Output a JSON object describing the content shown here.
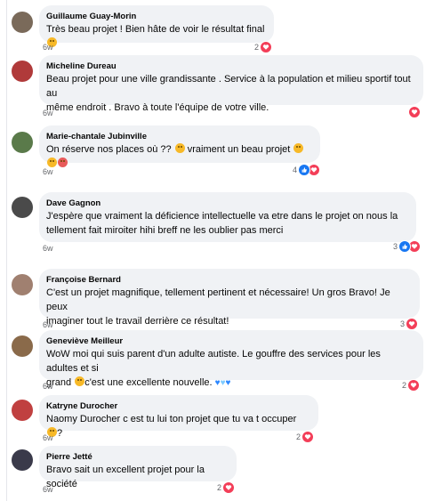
{
  "comments": [
    {
      "name": "Guillaume Guay-Morin",
      "line1": "Très beau projet ! Bien hâte de voir le résultat final",
      "line2": "",
      "time": "6w",
      "reactions": "2",
      "avatar_color": "#7a6a5a"
    },
    {
      "name": "Micheline Dureau",
      "line1": "Beau projet pour une ville grandissante . Service à la population et milieu sportif tout au",
      "line2": "même endroit . Bravo à toute l'équipe de votre ville.",
      "time": "6w",
      "reactions": "",
      "avatar_color": "#b03a3a"
    },
    {
      "name": "Marie-chantale Jubinville",
      "line1": "On réserve nos places où ?? ",
      "line1b": " vraiment un beau projet ",
      "line2": "",
      "time": "6w",
      "reactions": "4",
      "avatar_color": "#5a7a4a"
    },
    {
      "name": "Dave Gagnon",
      "line1": "J'espère que vraiment la déficience intellectuelle va etre dans le projet on nous la",
      "line2": "tellement fait miroiter hihi breff ne les oublier pas merci",
      "time": "6w",
      "reactions": "3",
      "avatar_color": "#4a4a4a"
    },
    {
      "name": "Françoise Bernard",
      "line1": "C'est un projet magnifique, tellement pertinent et nécessaire! Un gros Bravo! Je peux",
      "line2": "imaginer tout le travail derrière ce résultat!",
      "time": "6w",
      "reactions": "3",
      "avatar_color": "#a08070"
    },
    {
      "name": "Geneviève Meilleur",
      "line1": "WoW moi qui suis parent d'un adulte autiste. Le gouffre des services pour les adultes et si",
      "line2": "grand ",
      "line2b": "c'est une excellente nouvelle. ",
      "time": "6w",
      "reactions": "2",
      "avatar_color": "#8a6a4a"
    },
    {
      "name": "Katryne Durocher",
      "line1": "Naomy Durocher c est tu lui ton projet que tu va t occuper ",
      "line1b": "?",
      "line2": "",
      "time": "6w",
      "reactions": "2",
      "avatar_color": "#c04040"
    },
    {
      "name": "Pierre Jetté",
      "line1": "Bravo sait un excellent projet pour la société",
      "line2": "",
      "time": "6w",
      "reactions": "2",
      "avatar_color": "#3a3a4a"
    }
  ]
}
